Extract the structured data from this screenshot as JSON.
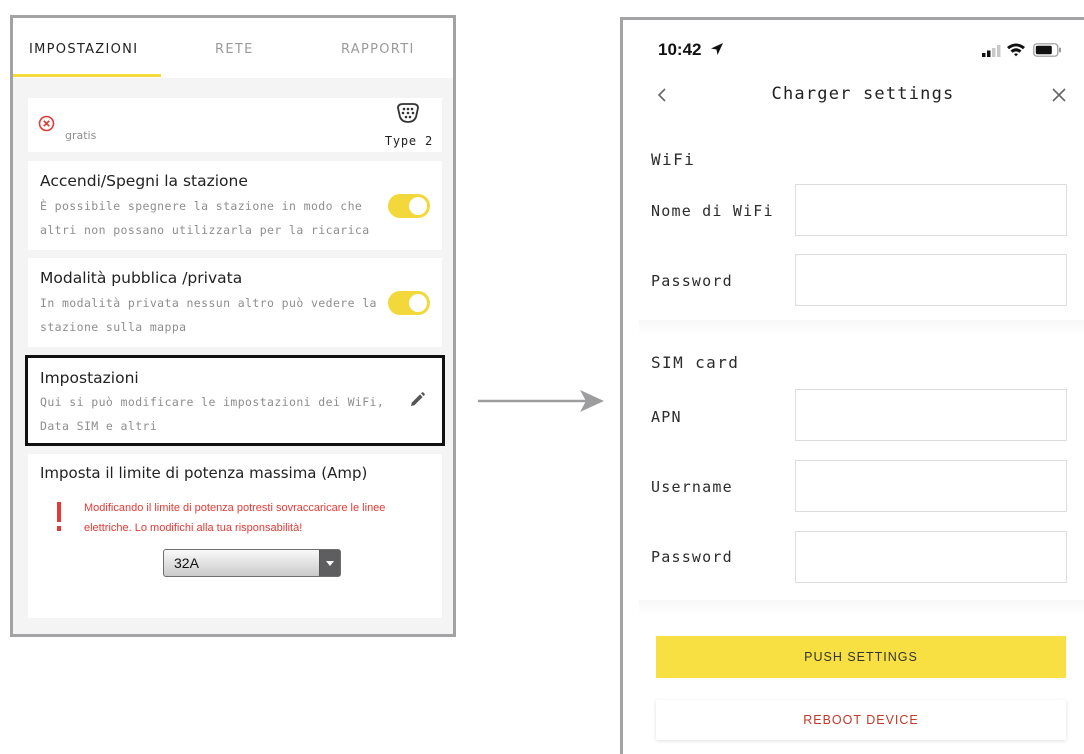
{
  "left": {
    "tabs": [
      {
        "label": "IMPOSTAZIONI",
        "active": true
      },
      {
        "label": "RETE",
        "active": false
      },
      {
        "label": "RAPPORTI",
        "active": false
      }
    ],
    "price_text": "gratis",
    "connector_label": "Type 2",
    "power_toggle": {
      "title": "Accendi/Spegni la stazione",
      "description": "È possibile spegnere la stazione in modo che altri non possano utilizzarla per la ricarica",
      "enabled": true
    },
    "privacy_toggle": {
      "title": "Modalità pubblica /privata",
      "description": "In modalità privata nessun altro può vedere la stazione sulla mappa",
      "enabled": true
    },
    "settings_item": {
      "title": "Impostazioni",
      "description": "Qui si può modificare le impostazioni dei WiFi, Data SIM e altri"
    },
    "power_limit": {
      "title": "Imposta il limite di potenza massima (Amp)",
      "warning": "Modificando il limite di potenza potresti sovraccaricare le linee elettriche. Lo modifichi alla tua risponsabilità!",
      "selected": "32A"
    }
  },
  "right": {
    "status_time": "10:42",
    "nav_title": "Charger settings",
    "wifi": {
      "section_label": "WiFi",
      "name_label": "Nome di WiFi",
      "name_value": "",
      "password_label": "Password",
      "password_value": ""
    },
    "sim": {
      "section_label": "SIM card",
      "apn_label": "APN",
      "apn_value": "",
      "username_label": "Username",
      "username_value": "",
      "password_label": "Password",
      "password_value": ""
    },
    "push_label": "PUSH SETTINGS",
    "reboot_label": "REBOOT DEVICE"
  },
  "colors": {
    "accent_yellow": "#f9e042",
    "toggle_on": "#f2d83a",
    "warning_red": "#e53935",
    "reboot_red": "#c0392b",
    "frame_gray": "#a3a3a5"
  },
  "icons": [
    "cancel-circle-icon",
    "type2-connector-icon",
    "edit-pencil-icon",
    "warning-exclamation-icon",
    "back-chevron-icon",
    "close-icon",
    "location-arrow-icon",
    "signal-icon",
    "wifi-icon",
    "battery-icon",
    "flow-arrow-icon"
  ]
}
